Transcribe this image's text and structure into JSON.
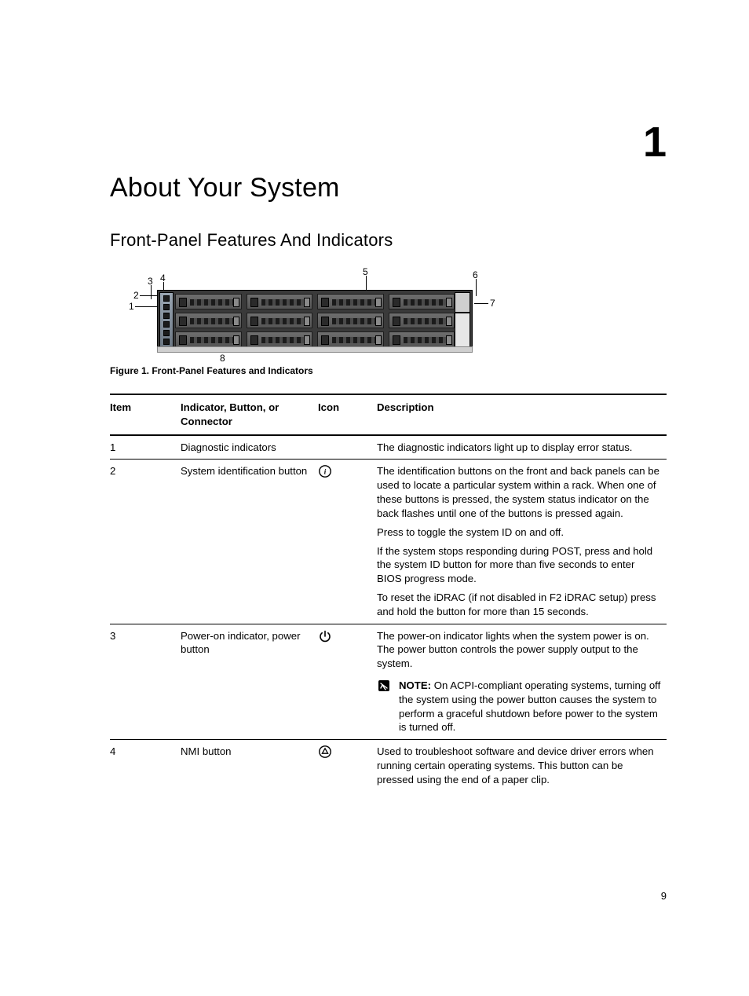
{
  "chapter_number": "1",
  "heading": "About Your System",
  "subheading": "Front-Panel Features And Indicators",
  "figure_caption": "Figure 1. Front-Panel Features and Indicators",
  "callouts": {
    "c1": "1",
    "c2": "2",
    "c3": "3",
    "c4": "4",
    "c5": "5",
    "c6": "6",
    "c7": "7",
    "c8": "8"
  },
  "table": {
    "headers": {
      "item": "Item",
      "indicator": "Indicator, Button, or Connector",
      "icon": "Icon",
      "description": "Description"
    },
    "rows": [
      {
        "item": "1",
        "indicator": "Diagnostic indicators",
        "icon": "",
        "description": [
          "The diagnostic indicators light up to display error status."
        ]
      },
      {
        "item": "2",
        "indicator": "System identification button",
        "icon": "id",
        "description": [
          "The identification buttons on the front and back panels can be used to locate a particular system within a rack. When one of these buttons is pressed, the system status indicator on the back flashes until one of the buttons is pressed again.",
          "Press to toggle the system ID on and off.",
          "If the system stops responding during POST, press and hold the system ID button for more than five seconds to enter BIOS progress mode.",
          "To reset the iDRAC (if not disabled in F2 iDRAC setup) press and hold the button for more than 15 seconds."
        ]
      },
      {
        "item": "3",
        "indicator": "Power-on indicator, power button",
        "icon": "power",
        "description": [
          "The power-on indicator lights when the system power is on. The power button controls the power supply output to the system."
        ],
        "note": {
          "label": "NOTE:",
          "text": " On ACPI-compliant operating systems, turning off the system using the power button causes the system to perform a graceful shutdown before power to the system is turned off."
        }
      },
      {
        "item": "4",
        "indicator": "NMI button",
        "icon": "nmi",
        "description": [
          "Used to troubleshoot software and device driver errors when running certain operating systems. This button can be pressed using the end of a paper clip."
        ]
      }
    ]
  },
  "page_number": "9"
}
